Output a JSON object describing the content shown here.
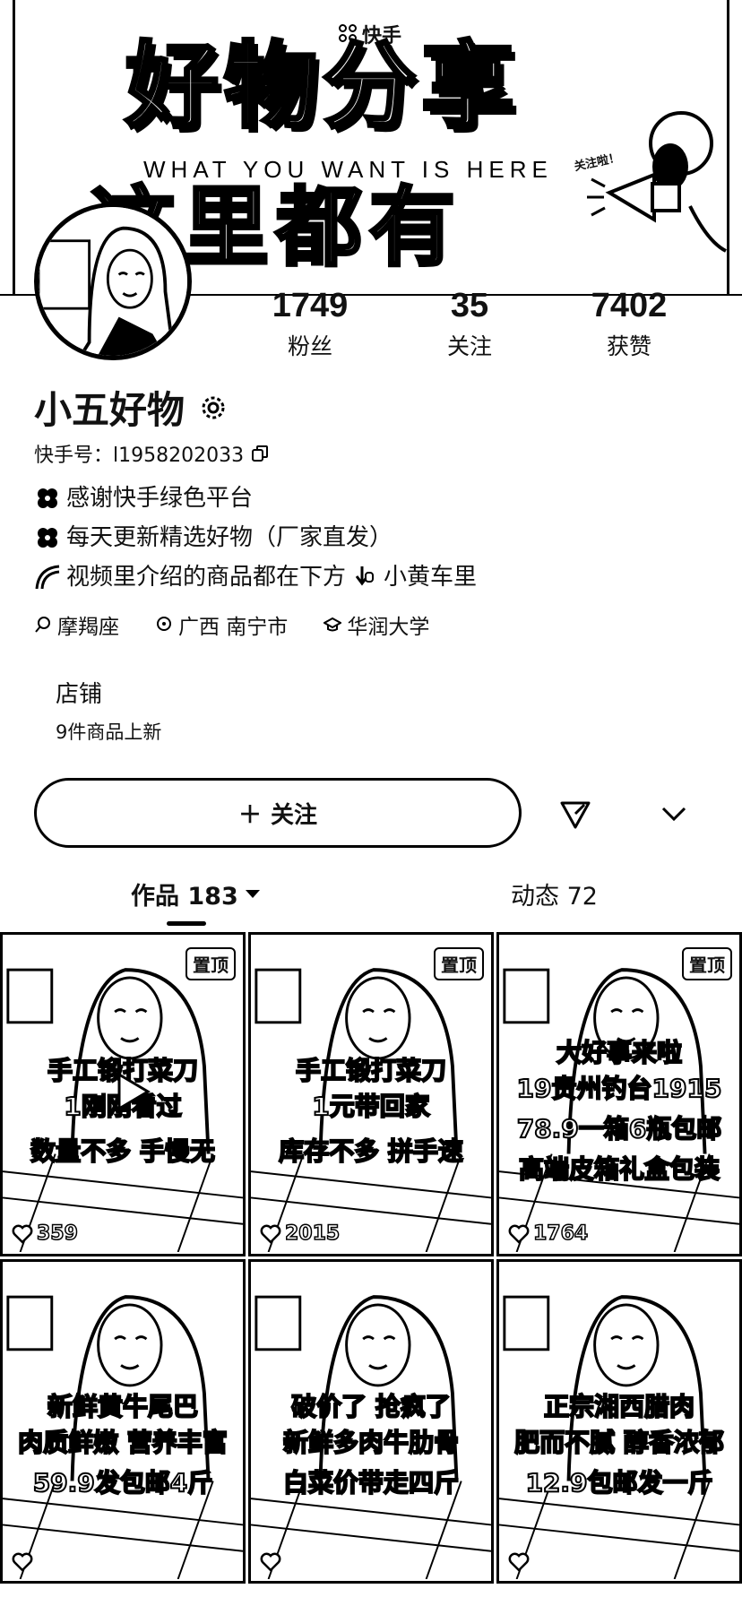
{
  "banner": {
    "brand": "快手",
    "title": "好物分享",
    "subtitle": "WHAT YOU WANT IS HERE",
    "title2": "这里都有",
    "bubble": "关注啦！"
  },
  "stats": [
    {
      "value": "1749",
      "label": "粉丝"
    },
    {
      "value": "35",
      "label": "关注"
    },
    {
      "value": "7402",
      "label": "获赞"
    }
  ],
  "profile": {
    "name": "小五好物",
    "uid": "快手号：l1958202033"
  },
  "bio": [
    "感谢快手绿色平台",
    "每天更新精选好物（厂家直发）",
    "视频里介绍的商品都在下方",
    "小黄车里"
  ],
  "tags": [
    "摩羯座",
    "广西 南宁市",
    "华润大学"
  ],
  "shop": {
    "title": "店铺",
    "subtitle": "9件商品上新"
  },
  "actions": {
    "follow": "关注",
    "follow_prefix": "＋"
  },
  "tabs": {
    "works": "作品 183",
    "moments": "动态 72"
  },
  "videos": [
    {
      "pinned": "置顶",
      "lines": [
        "手工锻打菜刀",
        "1刚刚看过",
        "数量不多 手慢无"
      ],
      "likes": "359"
    },
    {
      "pinned": "置顶",
      "lines": [
        "手工锻打菜刀",
        "1元带回家",
        "库存不多 拼手速"
      ],
      "likes": "2015"
    },
    {
      "pinned": "置顶",
      "lines": [
        "大好事来啦",
        "19贵州钓台1915",
        "78.9一箱6瓶包邮",
        "高端皮箱礼盒包装"
      ],
      "likes": "1764"
    },
    {
      "pinned": "",
      "lines": [
        "新鲜黄牛尾巴",
        "肉质鲜嫩 营养丰富",
        "59.9发包邮4斤"
      ],
      "likes": ""
    },
    {
      "pinned": "",
      "lines": [
        "破价了 抢疯了",
        "新鲜多肉牛肋骨",
        "白菜价带走四斤"
      ],
      "likes": ""
    },
    {
      "pinned": "",
      "lines": [
        "正宗湘西腊肉",
        "肥而不腻 醇香浓郁",
        "12.9包邮发一斤"
      ],
      "likes": ""
    }
  ]
}
